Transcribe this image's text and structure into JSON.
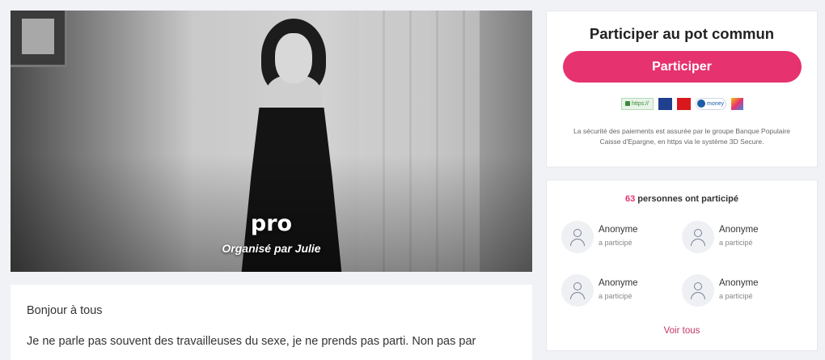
{
  "hero": {
    "title": "pro",
    "organizer": "Organisé par Julie"
  },
  "description": {
    "greeting": "Bonjour à tous",
    "paragraph": "Je ne parle pas souvent des travailleuses du sexe, je ne prends pas parti. Non pas par"
  },
  "payment_card": {
    "heading": "Participer au pot commun",
    "button_label": "Participer",
    "logos": {
      "https_label": "https://",
      "smoney_label": "money"
    },
    "security_note": "La sécurité des paiements est assurée par le groupe Banque Populaire Caisse d'Epargne, en https via le système 3D Secure."
  },
  "participants_card": {
    "count": "63",
    "count_suffix": "personnes ont participé",
    "participants": [
      {
        "name": "Anonyme",
        "status": "a participé"
      },
      {
        "name": "Anonyme",
        "status": "a participé"
      },
      {
        "name": "Anonyme",
        "status": "a participé"
      },
      {
        "name": "Anonyme",
        "status": "a participé"
      }
    ],
    "see_all_label": "Voir tous"
  },
  "colors": {
    "accent": "#e6326e",
    "link": "#c43368",
    "background": "#f0f2f5"
  }
}
